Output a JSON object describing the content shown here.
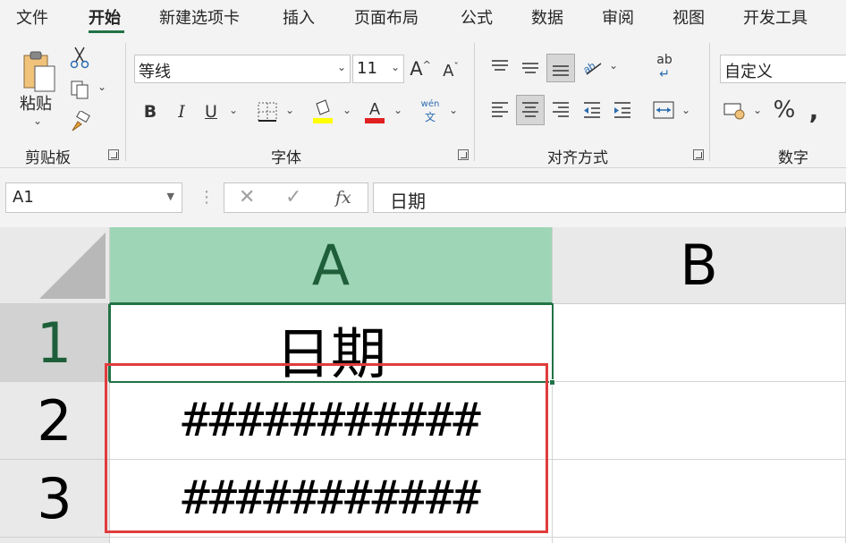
{
  "menu": {
    "tabs": [
      "文件",
      "开始",
      "新建选项卡",
      "插入",
      "页面布局",
      "公式",
      "数据",
      "审阅",
      "视图",
      "开发工具"
    ],
    "active_tab": "开始"
  },
  "ribbon": {
    "clipboard": {
      "paste_label": "粘贴",
      "group_label": "剪贴板"
    },
    "font": {
      "font_name": "等线",
      "font_size": "11",
      "group_label": "字体",
      "phonetic_top": "wén",
      "phonetic_bottom": "文"
    },
    "alignment": {
      "group_label": "对齐方式",
      "wrap_icon_text": "ab"
    },
    "number": {
      "format": "自定义",
      "group_label": "数字"
    }
  },
  "formula_bar": {
    "name_box": "A1",
    "fx_label": "fx",
    "content": "日期"
  },
  "sheet": {
    "columns": [
      "A",
      "B"
    ],
    "selected_column": "A",
    "rows": [
      {
        "header": "1",
        "cells": [
          "日期",
          ""
        ]
      },
      {
        "header": "2",
        "cells": [
          "###########",
          ""
        ]
      },
      {
        "header": "3",
        "cells": [
          "###########",
          ""
        ]
      }
    ],
    "active_cell": "A1",
    "highlight_color": "#e03c3c",
    "accent_color": "#217346"
  }
}
